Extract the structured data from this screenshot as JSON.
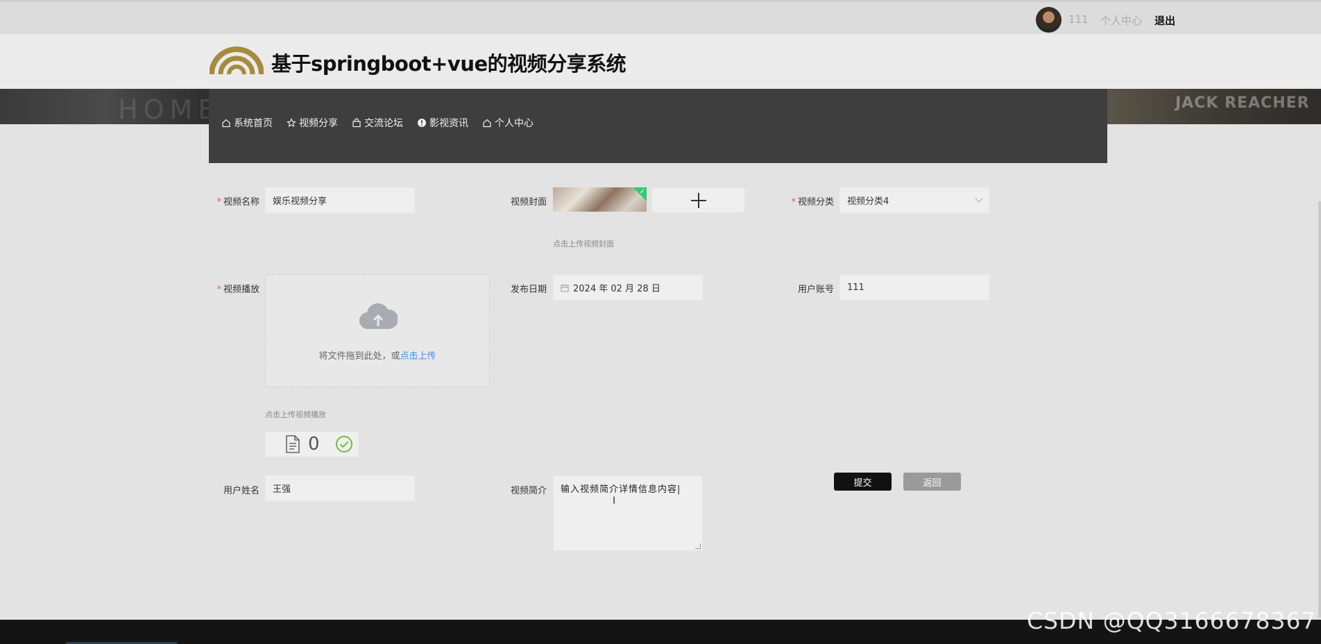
{
  "topbar": {
    "username": "111",
    "personal_center": "个人中心",
    "logout": "退出"
  },
  "header": {
    "title": "基于springboot+vue的视频分享系统"
  },
  "banner": {
    "left_text": "HOME",
    "right_text": "JACK REACHER"
  },
  "nav": {
    "items": [
      {
        "label": "系统首页",
        "icon": "home-icon"
      },
      {
        "label": "视频分享",
        "icon": "star-icon"
      },
      {
        "label": "交流论坛",
        "icon": "bag-icon"
      },
      {
        "label": "影视资讯",
        "icon": "info-icon"
      },
      {
        "label": "个人中心",
        "icon": "home-icon"
      }
    ]
  },
  "form": {
    "video_name": {
      "label": "视频名称",
      "required": true,
      "value": "娱乐视频分享"
    },
    "video_cover": {
      "label": "视频封面",
      "hint": "点击上传视频封面",
      "add_icon": "plus-icon"
    },
    "video_category": {
      "label": "视频分类",
      "required": true,
      "value": "视频分类4"
    },
    "video_play": {
      "label": "视频播放",
      "required": true,
      "drop_text": "将文件拖到此处，或",
      "drop_link": "点击上传",
      "hint": "点击上传视频播放",
      "file_count": "0"
    },
    "publish_date": {
      "label": "发布日期",
      "value": "2024 年 02 月 28 日"
    },
    "user_account": {
      "label": "用户账号",
      "value": "111"
    },
    "user_name": {
      "label": "用户姓名",
      "value": "王强"
    },
    "video_intro": {
      "label": "视频简介",
      "value": "输入视频简介详情信息内容|"
    },
    "submit_label": "提交",
    "back_label": "返回"
  },
  "watermark": "CSDN @QQ3166678367",
  "colors": {
    "accent": "#111111",
    "nav_bg": "#3e3e3e",
    "required": "#e35b5b",
    "link": "#3a8ee6",
    "success": "#67c23a"
  }
}
